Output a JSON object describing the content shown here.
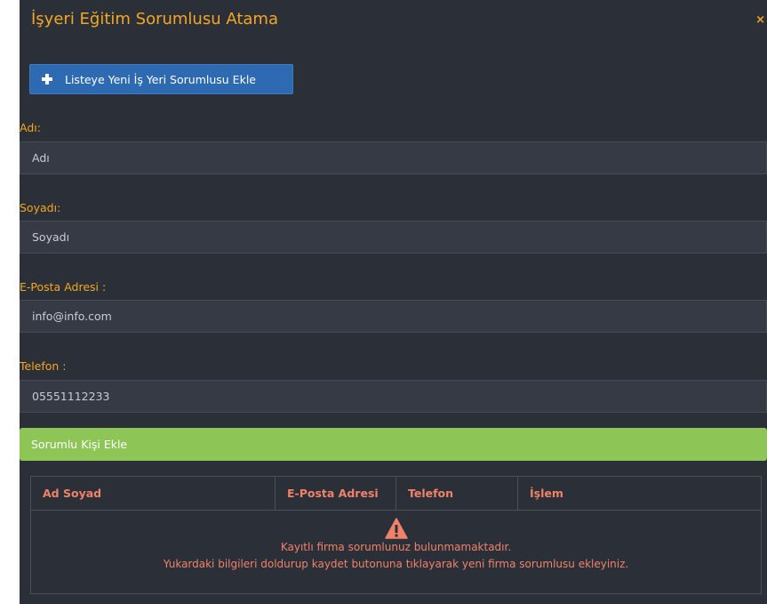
{
  "modal": {
    "title": "İşyeri Eğitim Sorumlusu Atama",
    "close_icon": "×"
  },
  "add_button": {
    "label": "Listeye Yeni İş Yeri Sorumlusu Ekle",
    "icon": "plus-icon"
  },
  "form": {
    "first_name": {
      "label": "Adı:",
      "value": "Adı"
    },
    "last_name": {
      "label": "Soyadı:",
      "value": "Soyadı"
    },
    "email": {
      "label": "E-Posta Adresi :",
      "value": "info@info.com"
    },
    "phone": {
      "label": "Telefon :",
      "value": "05551112233"
    }
  },
  "submit_button": {
    "label": "Sorumlu Kişi Ekle"
  },
  "table": {
    "headers": [
      "Ad Soyad",
      "E-Posta Adresi",
      "Telefon",
      "İşlem"
    ],
    "empty": {
      "icon": "warning-icon",
      "line1": "Kayıtlı firma sorumlunuz bulunmamaktadır.",
      "line2": "Yukardaki bilgileri doldurup kaydet butonuna tıklayarak yeni firma sorumlusu ekleyiniz."
    }
  },
  "colors": {
    "background": "#2b2f37",
    "accent": "#f5a623",
    "button": "#2d6ab1",
    "submit": "#8dc657",
    "table_text": "#f0826a"
  }
}
